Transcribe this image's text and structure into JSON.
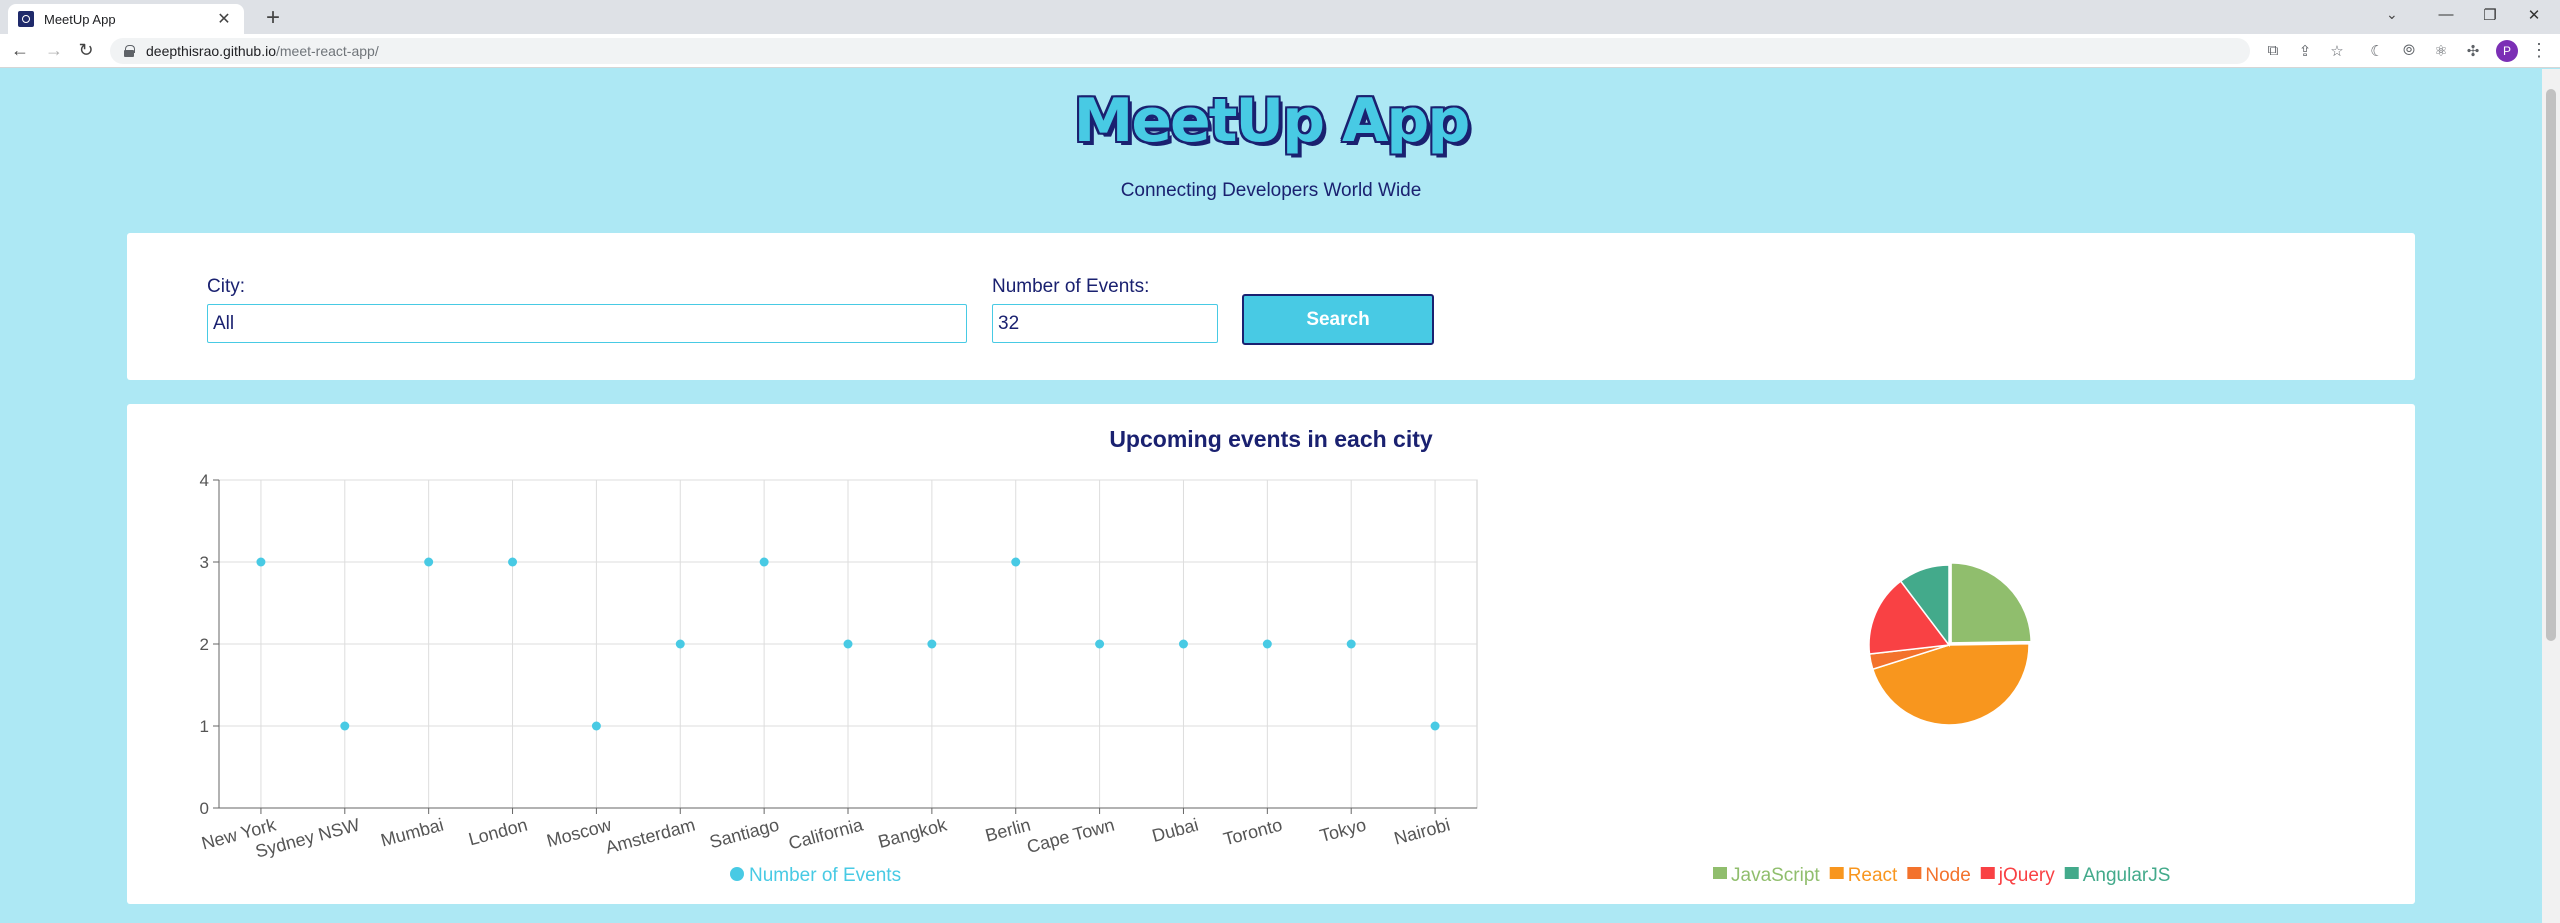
{
  "browser": {
    "tab_title": "MeetUp App",
    "url_host": "deepthisrao.github.io",
    "url_path": "/meet-react-app/",
    "profile_initial": "P"
  },
  "header": {
    "title": "MeetUp App",
    "subtitle": "Connecting Developers World Wide"
  },
  "search": {
    "city_label": "City:",
    "city_value": "All",
    "events_label": "Number of Events:",
    "events_value": "32",
    "button_label": "Search"
  },
  "chart_section": {
    "title": "Upcoming events in each city"
  },
  "colors": {
    "accent": "#48cae4",
    "navy": "#1a2170",
    "background": "#ade8f4"
  },
  "chart_data": [
    {
      "type": "scatter",
      "categories": [
        "New York",
        "Sydney NSW",
        "Mumbai",
        "London",
        "Moscow",
        "Amsterdam",
        "Santiago",
        "California",
        "Bangkok",
        "Berlin",
        "Cape Town",
        "Dubai",
        "Toronto",
        "Tokyo",
        "Nairobi"
      ],
      "series": [
        {
          "name": "Number of Events",
          "values": [
            3,
            1,
            3,
            3,
            1,
            2,
            3,
            2,
            2,
            3,
            2,
            2,
            2,
            2,
            1
          ],
          "color": "#48cae4"
        }
      ],
      "ylim": [
        0,
        4
      ],
      "yticks": [
        "0",
        "1",
        "2",
        "3",
        "4"
      ],
      "grid": true,
      "legend": "bottom"
    },
    {
      "type": "pie",
      "labels": [
        "JavaScript",
        "React",
        "Node",
        "jQuery",
        "AngularJS"
      ],
      "values": [
        24,
        44,
        3,
        16,
        10
      ],
      "colors": [
        "#90be6d",
        "#f8961e",
        "#f3722c",
        "#f94144",
        "#43aa8b"
      ],
      "legend": "bottom"
    }
  ]
}
